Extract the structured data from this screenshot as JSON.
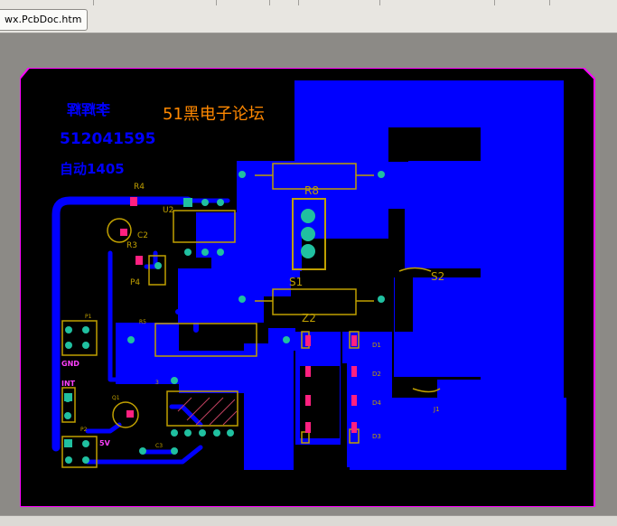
{
  "window": {
    "tab_label": "wx.PcbDoc.htm"
  },
  "board": {
    "title_cn": "51黑电子论坛",
    "mirror_name": "李辉辉",
    "mirror_id": "512041595",
    "mirror_class": "自动1405",
    "colors": {
      "copper": "#0000ff",
      "board": "#000000",
      "outline": "#ff00ff",
      "silk": "#c0a000",
      "text_orange": "#ff8800"
    }
  },
  "components": {
    "r1": "R4",
    "u2": "U2",
    "c2": "C2",
    "r3": "R3",
    "p4": "P4",
    "r5": "R5",
    "p1": "P1",
    "gnd": "GND",
    "int": "INT",
    "p2": "P2",
    "v5": "5V",
    "q1": "Q1",
    "c3": "C3",
    "d_ref": "D1",
    "r8": "R8",
    "j1": "J1",
    "s1": "S1",
    "s2": "S2",
    "z2": "Z2",
    "d1": "D1",
    "d2": "D2",
    "d4": "D4",
    "d3": "D3",
    "j2": "J1",
    "pad3": "3"
  }
}
